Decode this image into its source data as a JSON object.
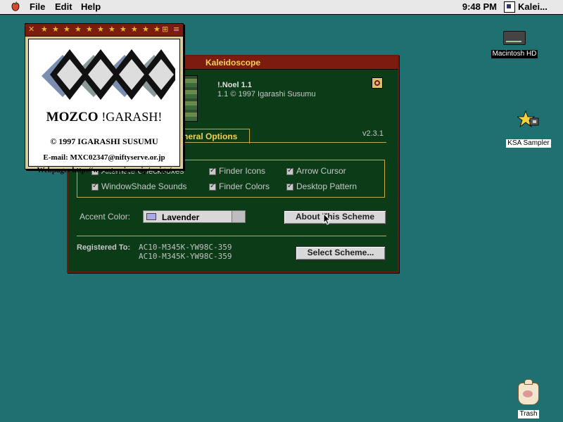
{
  "menubar": {
    "items": [
      "File",
      "Edit",
      "Help"
    ],
    "clock": "9:48 PM",
    "app_menu": "Kalei..."
  },
  "desktop": {
    "icons": [
      {
        "label": "Macintosh HD",
        "icon": "hard-drive-icon"
      },
      {
        "label": "KSA Sampler",
        "icon": "sampler-icon"
      },
      {
        "label": "Trash",
        "icon": "trash-icon"
      }
    ],
    "background_color": "#1f7070"
  },
  "kaleidoscope": {
    "title": "Kaleidoscope",
    "scheme_name": "!.Noel 1.1",
    "scheme_copyright": "1.1 © 1997 Igarashi Susumu",
    "version": "v2.3.1",
    "tab_label": "neral Options",
    "checkboxes": [
      {
        "label": "Alternate Checkboxes",
        "checked": false
      },
      {
        "label": "Finder Icons",
        "checked": true
      },
      {
        "label": "Arrow Cursor",
        "checked": true
      },
      {
        "label": "WindowShade Sounds",
        "checked": true
      },
      {
        "label": "Finder Colors",
        "checked": true
      },
      {
        "label": "Desktop Pattern",
        "checked": true
      }
    ],
    "accent_label": "Accent Color:",
    "accent_value": "Lavender",
    "about_button": "About This Scheme",
    "registered_label": "Registered To:",
    "registration_codes": [
      "AC10-M345K-YW98C-359",
      "AC10-M345K-YW98C-359"
    ],
    "select_button": "Select Scheme...",
    "colors": {
      "title_bar": "#7b1c0f",
      "panel": "#0b3b17",
      "accent_text": "#f3d24f"
    }
  },
  "mozco": {
    "logo_left": "MOZCO",
    "logo_right": "!GARASH!",
    "copyright": "© 1997 IGARASHI SUSUMU",
    "email": "E-mail: MXC02347@niftyserve.or.jp",
    "webpage": "Webpage: http://www.tcp-ip.or.jp/~s-iga/"
  }
}
